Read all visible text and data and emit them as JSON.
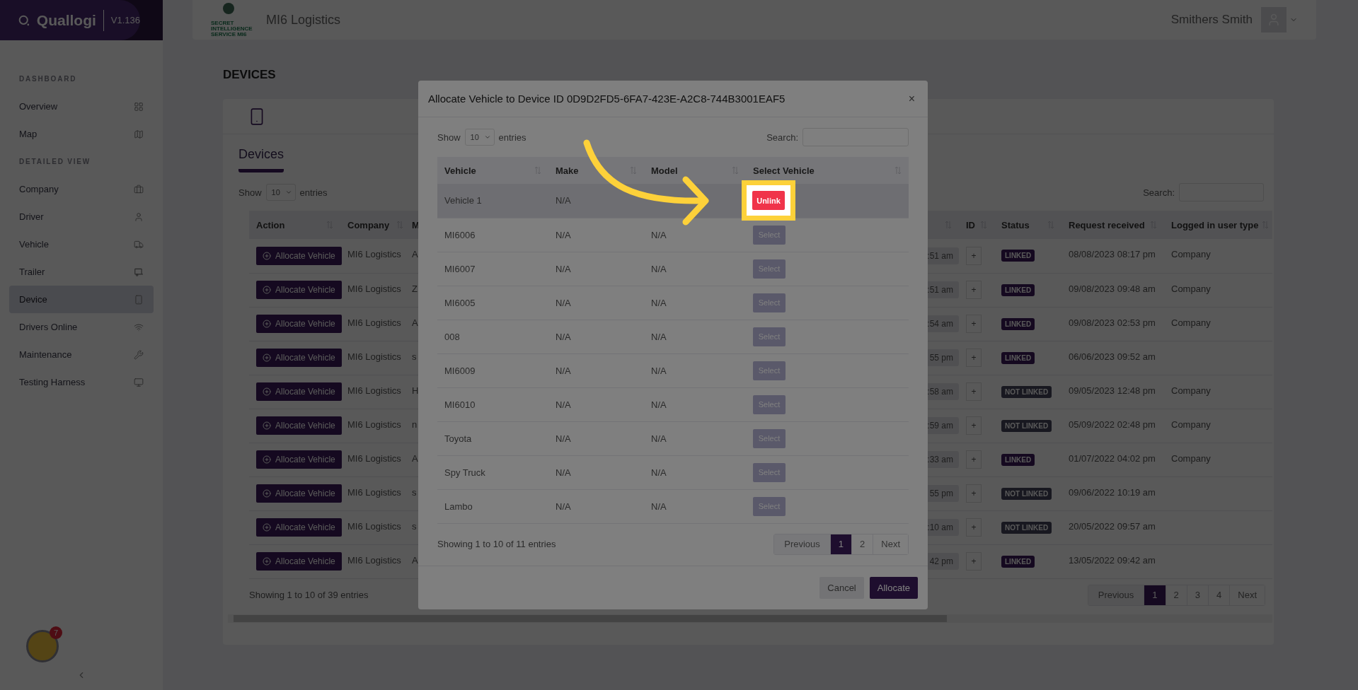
{
  "sidebar": {
    "brand": "Quallogi",
    "version": "V1.136",
    "sections": [
      {
        "title": "DASHBOARD",
        "items": [
          {
            "label": "Overview",
            "selected": false
          },
          {
            "label": "Map",
            "selected": false
          }
        ]
      },
      {
        "title": "DETAILED VIEW",
        "items": [
          {
            "label": "Company",
            "selected": false
          },
          {
            "label": "Driver",
            "selected": false
          },
          {
            "label": "Vehicle",
            "selected": false
          },
          {
            "label": "Trailer",
            "selected": false
          },
          {
            "label": "Device",
            "selected": true
          },
          {
            "label": "Drivers Online",
            "selected": false
          },
          {
            "label": "Maintenance",
            "selected": false
          },
          {
            "label": "Testing Harness",
            "selected": false
          }
        ]
      }
    ],
    "assistant_badge": "7"
  },
  "topbar": {
    "logo_lines": [
      "SECRET",
      "INTELLIGENCE",
      "SERVICE MI6"
    ],
    "company": "MI6 Logistics",
    "user": "Smithers Smith"
  },
  "page_title": "DEVICES",
  "card": {
    "tab": "Devices",
    "show_label": "Show",
    "page_size": "10",
    "entries_label": "entries",
    "search_label": "Search:",
    "columns": [
      {
        "label": "Action",
        "sort_icon": true
      },
      {
        "label": "Company",
        "sort_icon": true
      },
      {
        "label": "M",
        "sort_icon": false
      },
      {
        "sort_icon": true
      },
      {
        "label": "ID",
        "sort_icon": true
      },
      {
        "label": "Status",
        "sort_icon": true
      },
      {
        "label": "Request received",
        "sort_icon": true
      },
      {
        "label": "Logged in user type",
        "sort_icon": true
      }
    ],
    "rows": [
      {
        "action": "Allocate Vehicle",
        "company": "MI6 Logistics",
        "column_3": "A",
        "time": ":51 am",
        "id_button": "+",
        "status": "LINKED",
        "linked": true,
        "request_received": "08/08/2023 08:17 pm",
        "user_type": "Company"
      },
      {
        "action": "Allocate Vehicle",
        "company": "MI6 Logistics",
        "column_3": "Z",
        "time": ":51 am",
        "id_button": "+",
        "status": "LINKED",
        "linked": true,
        "request_received": "09/08/2023 09:48 am",
        "user_type": "Company"
      },
      {
        "action": "Allocate Vehicle",
        "company": "MI6 Logistics",
        "column_3": "A",
        "time": ":54 am",
        "id_button": "+",
        "status": "LINKED",
        "linked": true,
        "request_received": "09/08/2023 02:53 pm",
        "user_type": "Company"
      },
      {
        "action": "Allocate Vehicle",
        "company": "MI6 Logistics",
        "column_3": "s",
        "time": "55 pm",
        "id_button": "+",
        "status": "LINKED",
        "linked": true,
        "request_received": "06/06/2023 09:52 am"
      },
      {
        "action": "Allocate Vehicle",
        "company": "MI6 Logistics",
        "column_3": "H",
        "time": ":58 am",
        "id_button": "+",
        "status": "NOT LINKED",
        "linked": false,
        "request_received": "09/05/2023 12:48 pm",
        "user_type": "Company"
      },
      {
        "action": "Allocate Vehicle",
        "company": "MI6 Logistics",
        "column_3": "n",
        "time": ":59 am",
        "id_button": "+",
        "status": "NOT LINKED",
        "linked": false,
        "request_received": "05/09/2022 02:48 pm",
        "user_type": "Company"
      },
      {
        "action": "Allocate Vehicle",
        "company": "MI6 Logistics",
        "column_3": "A",
        "time": ":33 am",
        "id_button": "+",
        "status": "LINKED",
        "linked": true,
        "request_received": "01/07/2022 04:02 pm",
        "user_type": "Company"
      },
      {
        "action": "Allocate Vehicle",
        "company": "MI6 Logistics",
        "column_3": "s",
        "time": "55 pm",
        "id_button": "+",
        "status": "NOT LINKED",
        "linked": false,
        "request_received": "09/06/2022 10:19 am"
      },
      {
        "action": "Allocate Vehicle",
        "company": "MI6 Logistics",
        "column_3": "s",
        "time": ":10 am",
        "id_button": "+",
        "status": "NOT LINKED",
        "linked": false,
        "request_received": "20/05/2022 09:57 am"
      },
      {
        "action": "Allocate Vehicle",
        "company": "MI6 Logistics",
        "column_3": "A",
        "time": "42 pm",
        "id_button": "+",
        "status": "LINKED",
        "linked": true,
        "request_received": "13/05/2022 09:42 am"
      }
    ],
    "info": "Showing 1 to 10 of 39 entries",
    "pagination": {
      "previous": "Previous",
      "pages": [
        {
          "label": "1",
          "selected": true
        },
        {
          "label": "2",
          "selected": false
        },
        {
          "label": "3",
          "selected": false
        },
        {
          "label": "4",
          "selected": false
        }
      ],
      "next": "Next"
    }
  },
  "modal": {
    "title": "Allocate Vehicle to Device ID 0D9D2FD5-6FA7-423E-A2C8-744B3001EAF5",
    "close": "×",
    "show_label": "Show",
    "page_size": "10",
    "entries_label": "entries",
    "search_label": "Search:",
    "columns": [
      "Vehicle",
      "Make",
      "Model",
      "Select Vehicle"
    ],
    "rows": [
      {
        "vehicle": "Vehicle 1",
        "make": "N/A",
        "kind": "unlink",
        "button": "Unlink",
        "selected": true,
        "spotlight": true
      },
      {
        "vehicle": "MI6006",
        "make": "N/A",
        "model": "N/A",
        "kind": "select",
        "button": "Select",
        "selected": false,
        "spotlight": false
      },
      {
        "vehicle": "MI6007",
        "make": "N/A",
        "model": "N/A",
        "kind": "select",
        "button": "Select",
        "selected": false,
        "spotlight": false
      },
      {
        "vehicle": "MI6005",
        "make": "N/A",
        "model": "N/A",
        "kind": "select",
        "button": "Select",
        "selected": false,
        "spotlight": false
      },
      {
        "vehicle": "008",
        "make": "N/A",
        "model": "N/A",
        "kind": "select",
        "button": "Select",
        "selected": false,
        "spotlight": false
      },
      {
        "vehicle": "MI6009",
        "make": "N/A",
        "model": "N/A",
        "kind": "select",
        "button": "Select",
        "selected": false,
        "spotlight": false
      },
      {
        "vehicle": "MI6010",
        "make": "N/A",
        "model": "N/A",
        "kind": "select",
        "button": "Select",
        "selected": false,
        "spotlight": false
      },
      {
        "vehicle": "Toyota",
        "make": "N/A",
        "model": "N/A",
        "kind": "select",
        "button": "Select",
        "selected": false,
        "spotlight": false
      },
      {
        "vehicle": "Spy Truck",
        "make": "N/A",
        "model": "N/A",
        "kind": "select",
        "button": "Select",
        "selected": false,
        "spotlight": false
      },
      {
        "vehicle": "Lambo",
        "make": "N/A",
        "model": "N/A",
        "kind": "select",
        "button": "Select",
        "selected": false,
        "spotlight": false
      }
    ],
    "info": "Showing 1 to 10 of 11 entries",
    "pagination": {
      "previous": "Previous",
      "pages": [
        {
          "label": "1",
          "selected": true
        },
        {
          "label": "2",
          "selected": false
        }
      ],
      "next": "Next"
    },
    "cancel": "Cancel",
    "allocate": "Allocate"
  }
}
